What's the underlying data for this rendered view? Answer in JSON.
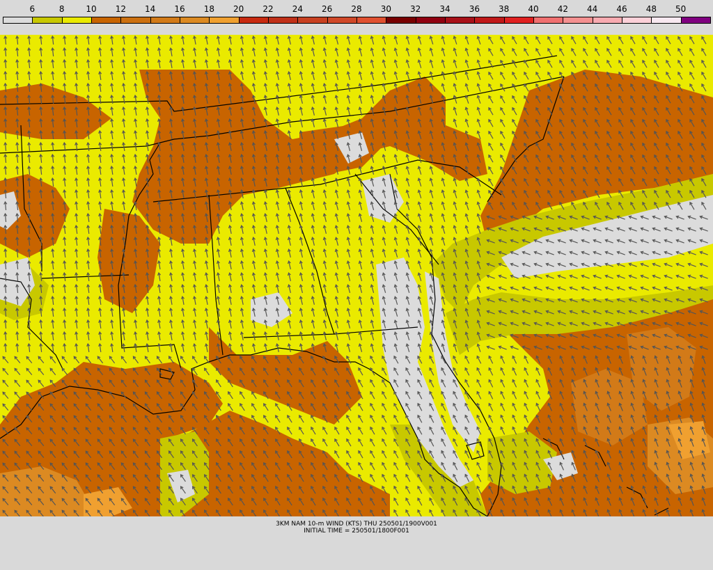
{
  "colorbar": {
    "labels": [
      "6",
      "8",
      "10",
      "12",
      "14",
      "16",
      "18",
      "20",
      "22",
      "24",
      "26",
      "28",
      "30",
      "32",
      "34",
      "36",
      "38",
      "40",
      "42",
      "44",
      "46",
      "48",
      "50"
    ],
    "colors": [
      "#dcdcdc",
      "#c8c800",
      "#eaea00",
      "#c86400",
      "#cc7010",
      "#d27a18",
      "#dc8a22",
      "#f0a030",
      "#c82a10",
      "#c03018",
      "#c84020",
      "#d04828",
      "#e05030",
      "#780000",
      "#900010",
      "#a81018",
      "#c01818",
      "#e02020",
      "#f07070",
      "#f49090",
      "#f8aab0",
      "#fcd0d8",
      "#f8e8f0",
      "#800080"
    ]
  },
  "map": {
    "color_legend": {
      "gray": "#dcdcdc",
      "olive": "#c8c800",
      "yellow": "#eaea00",
      "brown": "#c86400",
      "orange": "#dc8a22",
      "lightorange": "#f0a030",
      "border": "#000000",
      "arrow": "#555555"
    }
  },
  "caption": {
    "line1": "3KM NAM 10-m WIND (KTS) THU 250501/1900V001",
    "line2": "INITIAL TIME = 250501/1800F001"
  }
}
